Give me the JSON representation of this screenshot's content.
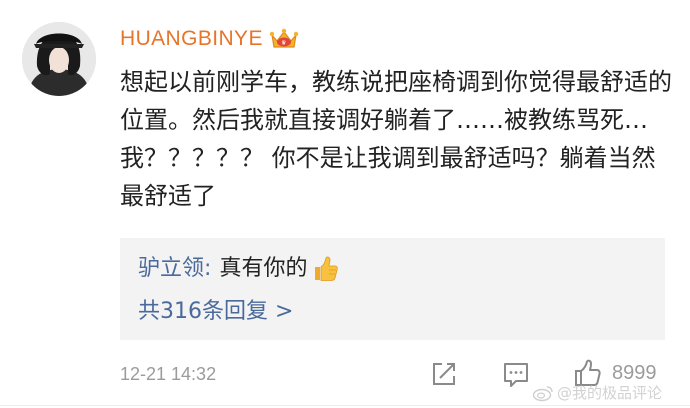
{
  "comment": {
    "username": "HUANGBINYE",
    "badge_icon": "crown-badge-icon",
    "text": "想起以前刚学车，教练说把座椅调到你觉得最舒适的位置。然后我就直接调好躺着了……被教练骂死…我？？？？？ 你不是让我调到最舒适吗？躺着当然最舒适了",
    "timestamp": "12-21 14:32",
    "like_count": "8999"
  },
  "reply": {
    "name": "驴立领",
    "colon": ":",
    "text": "真有你的",
    "emoji": "thumbs-up-emoji",
    "count_label": "共316条回复 >"
  },
  "actions": {
    "share_icon": "share-icon",
    "comment_icon": "comment-icon",
    "like_icon": "thumbs-up-icon"
  },
  "watermark": {
    "text": "@我的极品评论"
  },
  "colors": {
    "username": "#e8742a",
    "link": "#4a6a9c",
    "muted": "#9b9b9b",
    "reply_bg": "#f3f3f3"
  }
}
